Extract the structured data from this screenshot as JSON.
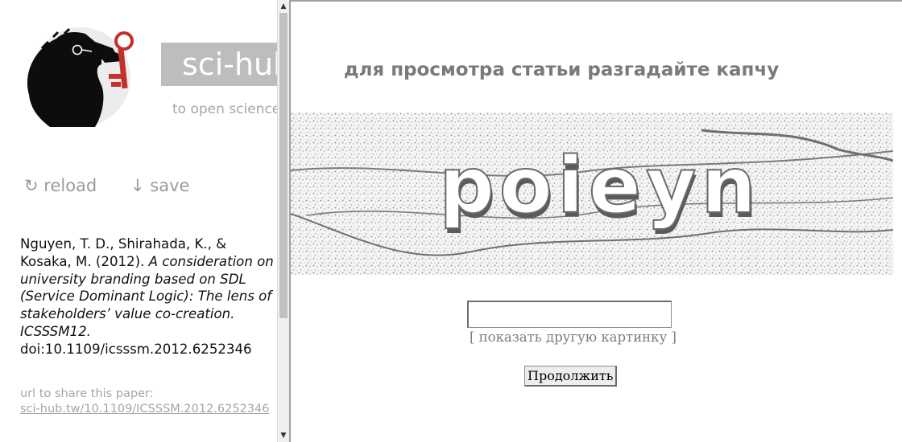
{
  "sidebar": {
    "brand": "sci-hub",
    "tagline": "to open science",
    "actions": {
      "reload": "↻ reload",
      "save": "↓ save"
    },
    "citation": {
      "authors": "Nguyen, T. D., Shirahada, K., & Kosaka, M. (2012).",
      "title": "A consideration on university branding based on SDL (Service Dominant Logic): The lens of stakeholders’ value co-creation. ICSSSM12.",
      "doi": "doi:10.1109/icsssm.2012.6252346"
    },
    "share": {
      "label": "url to share this paper:",
      "link": "sci-hub.tw/10.1109/ICSSSM.2012.6252346"
    }
  },
  "captcha": {
    "heading": "для просмотра статьи разгадайте капчу",
    "image_text": "poieyn",
    "input_value": "",
    "other_picture": "[ показать другую картинку ]",
    "submit": "Продолжить"
  },
  "icons": {
    "logo": "raven-with-key-logo",
    "scroll_up": "scroll-up-arrow-icon",
    "scroll_down": "scroll-down-arrow-icon"
  },
  "colors": {
    "brand_bg": "#bdbdbd",
    "key_red": "#c4302b",
    "muted_text": "#9b9b9b"
  }
}
